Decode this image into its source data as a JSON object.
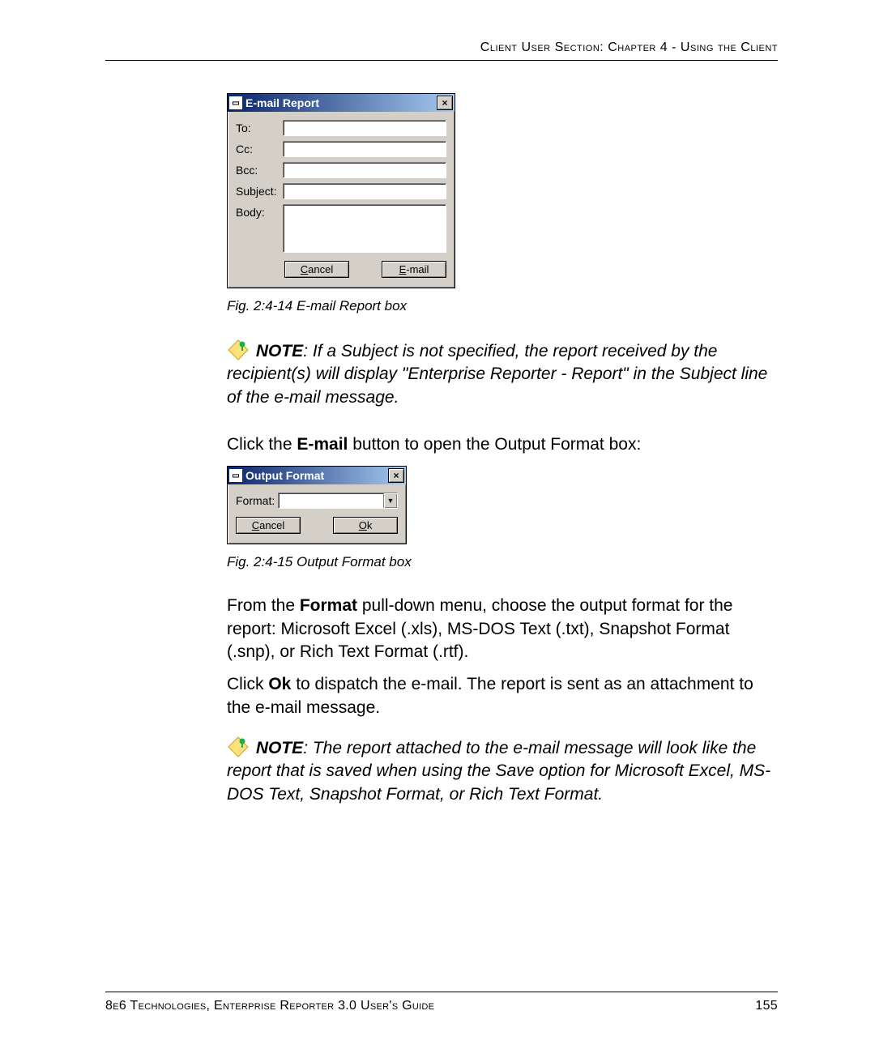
{
  "header": "Client User Section: Chapter 4 - Using the Client",
  "dialog1": {
    "title": "E-mail Report",
    "fields": {
      "to": "To:",
      "cc": "Cc:",
      "bcc": "Bcc:",
      "subject": "Subject:",
      "body": "Body:"
    },
    "buttons": {
      "cancel": "Cancel",
      "email": "E-mail"
    },
    "close": "×"
  },
  "caption1": "Fig. 2:4-14  E-mail Report box",
  "note1": {
    "label": "NOTE",
    "text": ": If a Subject is not specified, the report received by the recipient(s) will display \"Enterprise Reporter - Report\" in the Subject line of the e-mail message."
  },
  "para1_pre": "Click the ",
  "para1_bold": "E-mail",
  "para1_post": " button to open the Output Format box:",
  "dialog2": {
    "title": "Output Format",
    "format_label": "Format:",
    "buttons": {
      "cancel": "Cancel",
      "ok": "Ok"
    },
    "close": "×"
  },
  "caption2": "Fig. 2:4-15  Output Format box",
  "para2_pre": "From the ",
  "para2_bold": "Format",
  "para2_post": " pull-down menu, choose the output format for the report: Microsoft Excel (.xls), MS-DOS Text (.txt), Snapshot Format (.snp), or Rich Text Format (.rtf).",
  "para3_pre": "Click ",
  "para3_bold": "Ok",
  "para3_post": " to dispatch the e-mail. The report is sent as an attachment to the e-mail message.",
  "note2": {
    "label": "NOTE",
    "text": ": The report attached to the e-mail message will look like the report that is saved when using the Save option for Microsoft Excel, MS-DOS Text, Snapshot Format, or Rich Text Format."
  },
  "footer_left": "8e6 Technologies, Enterprise Reporter 3.0 User's Guide",
  "footer_right": "155"
}
